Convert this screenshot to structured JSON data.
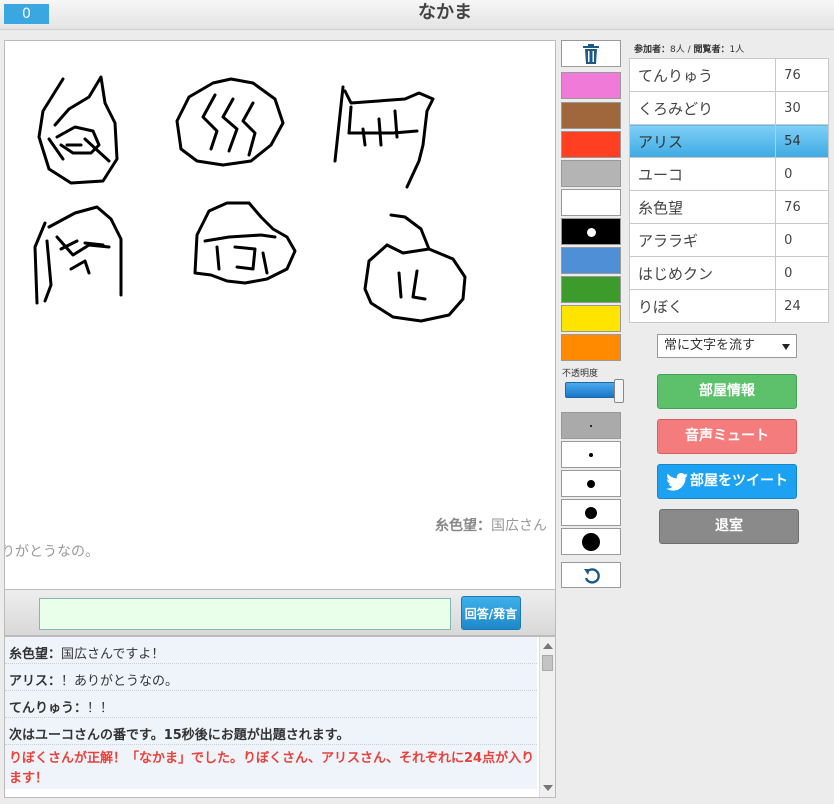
{
  "header": {
    "counter": "0",
    "title": "なかま"
  },
  "canvas": {
    "flow_line_1": {
      "speaker": "糸色望：",
      "text": "国広さん"
    },
    "flow_line_2": "りがとうなの。"
  },
  "input": {
    "value": "",
    "submit_label": "回答/発言"
  },
  "chat": [
    {
      "speaker": "糸色望：",
      "text": "国広さんですよ！"
    },
    {
      "speaker": "アリス：",
      "text": "！ありがとうなの。"
    },
    {
      "speaker": "てんりゅう：",
      "text": "！！"
    },
    {
      "text": "次はユーコさんの番です。15秒後にお題が出題されます。"
    },
    {
      "text": "りぼくさんが正解！「なかま」でした。りぼくさん、アリスさん、それぞれに24点が入ります！"
    }
  ],
  "tools": {
    "colors": [
      "#f07ad8",
      "#a0663c",
      "#ff3f22",
      "#b4b4b4",
      "#ffffff",
      "#000000",
      "#4f8fd6",
      "#3d9b2b",
      "#ffe400",
      "#ff8a00"
    ],
    "opacity_label": "不透明度",
    "opacity_value": 0.95
  },
  "room": {
    "participants_label": "参加者：",
    "participants": "8人",
    "separator": " / ",
    "viewers_label": "閲覧者：",
    "viewers": "1人"
  },
  "players": [
    {
      "name": "てんりゅう",
      "score": "76"
    },
    {
      "name": "くろみどり",
      "score": "30"
    },
    {
      "name": "アリス",
      "score": "54",
      "active": true
    },
    {
      "name": "ユーコ",
      "score": "0"
    },
    {
      "name": "糸色望",
      "score": "76"
    },
    {
      "name": "アララギ",
      "score": "0"
    },
    {
      "name": "はじめクン",
      "score": "0"
    },
    {
      "name": "りぼく",
      "score": "24"
    }
  ],
  "controls": {
    "flow_select": "常に文字を流す",
    "room_info": "部屋情報",
    "mute": "音声ミュート",
    "tweet": "部屋をツイート",
    "leave": "退室"
  }
}
